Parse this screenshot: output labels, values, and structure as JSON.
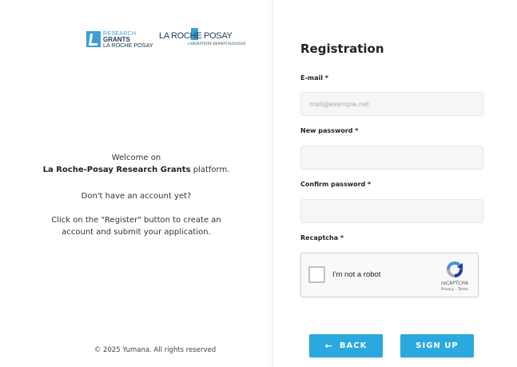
{
  "logos": {
    "research_line1": "RESEARCH",
    "research_line2": "GRANTS",
    "research_line3": "LA ROCHE POSAY",
    "lrp_main": "LA ROCHE POSAY",
    "lrp_sub": "LABORATOIRE DERMATOLOGIQUE"
  },
  "welcome": {
    "line1": "Welcome on",
    "line2_bold": "La Roche-Posay Research Grants",
    "line2_rest": " platform.",
    "line3": "Don't have an account yet?",
    "line4": "Click on the \"Register\" button to create an",
    "line5": "account and submit your application."
  },
  "footer": {
    "copyright": "© 2025 Yumana. All rights reserved"
  },
  "form": {
    "title": "Registration",
    "email_label": "E-mail *",
    "email_placeholder": "mail@exemple.net",
    "email_value": "",
    "password_label": "New password *",
    "password_value": "",
    "confirm_label": "Confirm password *",
    "confirm_value": "",
    "recaptcha_label": "Recaptcha *"
  },
  "recaptcha": {
    "checkbox_label": "I'm not a robot",
    "brand": "reCAPTCHA",
    "links": "Privacy - Terms",
    "checked": false
  },
  "buttons": {
    "back_arrow": "←",
    "back_label": "BACK",
    "signup_label": "SIGN UP"
  },
  "colors": {
    "accent": "#2aa9df",
    "brand_blue": "#3b9fd6",
    "brand_navy": "#1f3b57"
  }
}
